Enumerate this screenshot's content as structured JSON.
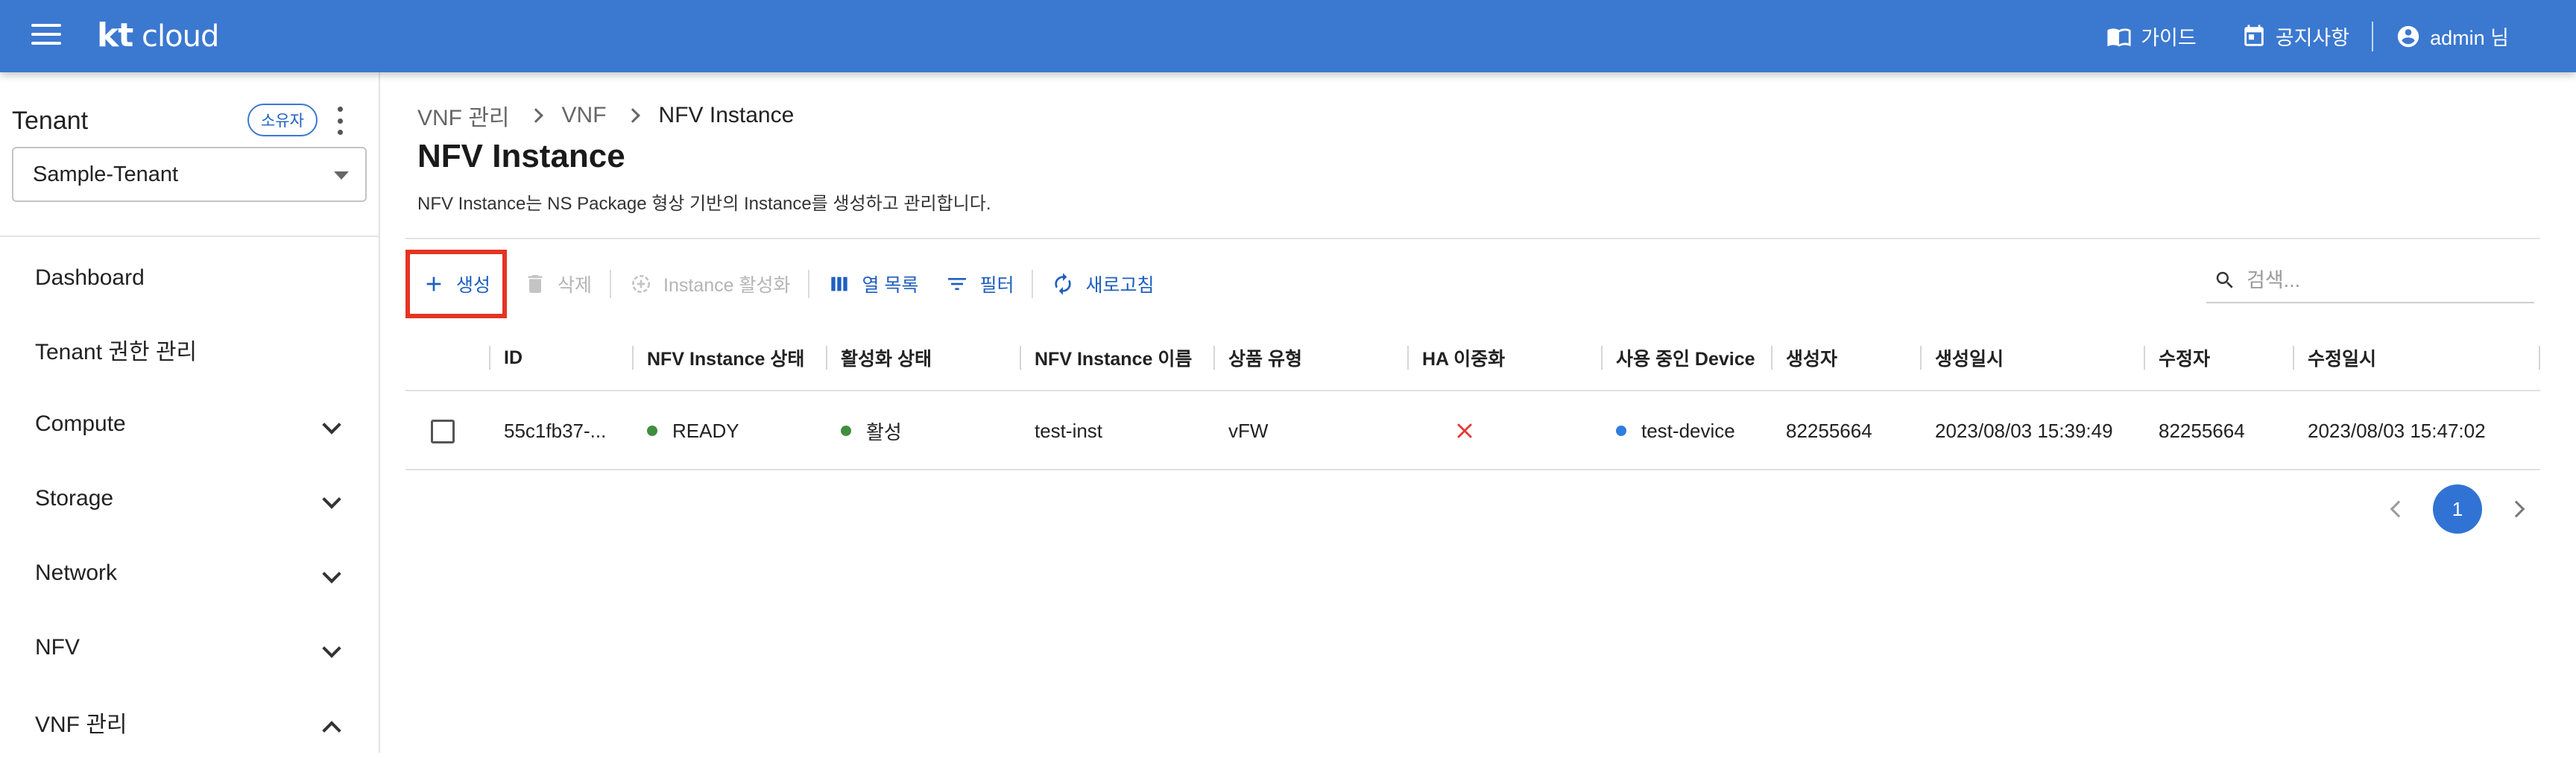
{
  "header": {
    "logo_kt": "kt",
    "logo_cloud": "cloud",
    "guide_label": "가이드",
    "notice_label": "공지사항",
    "user_label": "admin 님",
    "icons": [
      "menu-icon",
      "book-icon",
      "calendar-icon",
      "account-circle-icon"
    ],
    "bg_color": "#3b78d0"
  },
  "sidebar": {
    "tenant_title": "Tenant",
    "owner_badge": "소유자",
    "tenant_selected": "Sample-Tenant",
    "items": [
      {
        "label": "Dashboard",
        "expandable": false
      },
      {
        "label": "Tenant 권한 관리",
        "expandable": false
      },
      {
        "label": "Compute",
        "expandable": true,
        "expanded": false
      },
      {
        "label": "Storage",
        "expandable": true,
        "expanded": false
      },
      {
        "label": "Network",
        "expandable": true,
        "expanded": false
      },
      {
        "label": "NFV",
        "expandable": true,
        "expanded": false
      },
      {
        "label": "VNF 관리",
        "expandable": true,
        "expanded": true
      }
    ]
  },
  "breadcrumb": [
    "VNF 관리",
    "VNF",
    "NFV Instance"
  ],
  "page": {
    "title": "NFV Instance",
    "description": "NFV Instance는 NS Package 형상 기반의 Instance를 생성하고 관리합니다."
  },
  "toolbar": {
    "create": "생성",
    "delete": "삭제",
    "activate": "Instance 활성화",
    "columns": "열 목록",
    "filter": "필터",
    "refresh": "새로고침",
    "highlight_color": "#e53424"
  },
  "search": {
    "placeholder": "검색..."
  },
  "table": {
    "headers": [
      "ID",
      "NFV Instance 상태",
      "활성화 상태",
      "NFV Instance 이름",
      "상품 유형",
      "HA 이중화",
      "사용 중인 Device",
      "생성자",
      "생성일시",
      "수정자",
      "수정일시"
    ],
    "rows": [
      {
        "id": "55c1fb37-...",
        "status": "READY",
        "activation": "활성",
        "name": "test-inst",
        "product_type": "vFW",
        "ha": false,
        "device": "test-device",
        "creator": "82255664",
        "created_at": "2023/08/03 15:39:49",
        "modifier": "82255664",
        "modified_at": "2023/08/03 15:47:02"
      }
    ],
    "status_colors": {
      "ready": "#3f8f3f",
      "active": "#3f8f3f",
      "device": "#2f7ce0",
      "ha_false": "#e53935"
    }
  },
  "pagination": {
    "current": "1"
  }
}
